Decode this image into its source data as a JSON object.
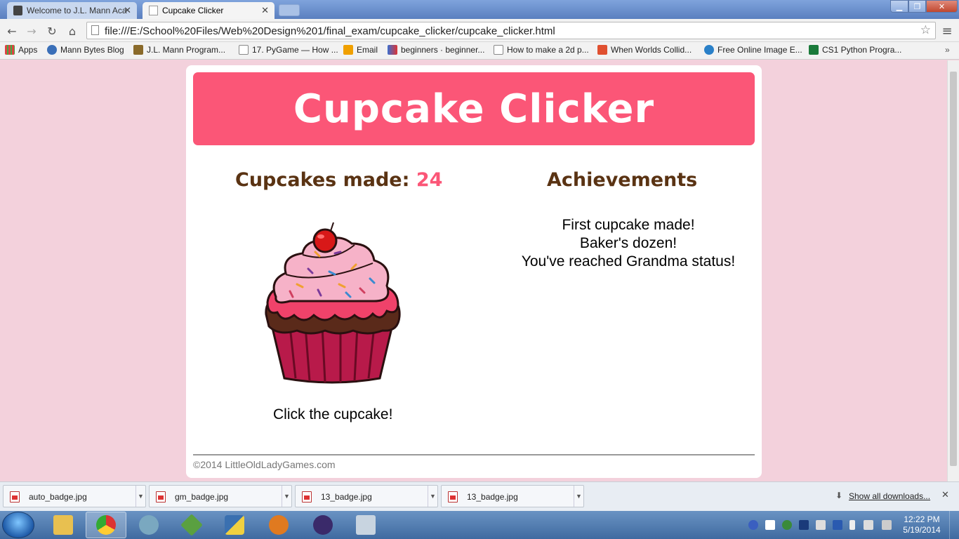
{
  "browser": {
    "tabs": [
      {
        "title": "Welcome to J.L. Mann Aca",
        "active": false
      },
      {
        "title": "Cupcake Clicker",
        "active": true
      }
    ],
    "url": "file:///E:/School%20Files/Web%20Design%201/final_exam/cupcake_clicker/cupcake_clicker.html",
    "bookmarks": [
      {
        "label": "Apps",
        "icon": "apps-grid-icon"
      },
      {
        "label": "Mann Bytes Blog",
        "icon": "globe-icon"
      },
      {
        "label": "J.L. Mann Program...",
        "icon": "school-icon"
      },
      {
        "label": "17. PyGame — How ...",
        "icon": "page-icon"
      },
      {
        "label": "Email",
        "icon": "email-icon"
      },
      {
        "label": "beginners · beginner...",
        "icon": "reddit-icon"
      },
      {
        "label": "How to make a 2d p...",
        "icon": "page-icon"
      },
      {
        "label": "When Worlds Collid...",
        "icon": "plus-icon"
      },
      {
        "label": "Free Online Image E...",
        "icon": "globe-icon"
      },
      {
        "label": "CS1 Python Progra...",
        "icon": "s-logo-icon"
      }
    ]
  },
  "page": {
    "title": "Cupcake Clicker",
    "counter_label": "Cupcakes made:",
    "counter_value": "24",
    "achievements_title": "Achievements",
    "achievements": [
      "First cupcake made!",
      "Baker's dozen!",
      "You've reached Grandma status!"
    ],
    "click_prompt": "Click the cupcake!",
    "footer": "©2014 LittleOldLadyGames.com"
  },
  "downloads": {
    "items": [
      "auto_badge.jpg",
      "gm_badge.jpg",
      "13_badge.jpg",
      "13_badge.jpg"
    ],
    "show_all": "Show all downloads..."
  },
  "taskbar": {
    "time": "12:22 PM",
    "date": "5/19/2014"
  },
  "colors": {
    "page_bg": "#f3d1dc",
    "header_pink": "#fb5677",
    "heading_brown": "#5a3313"
  }
}
